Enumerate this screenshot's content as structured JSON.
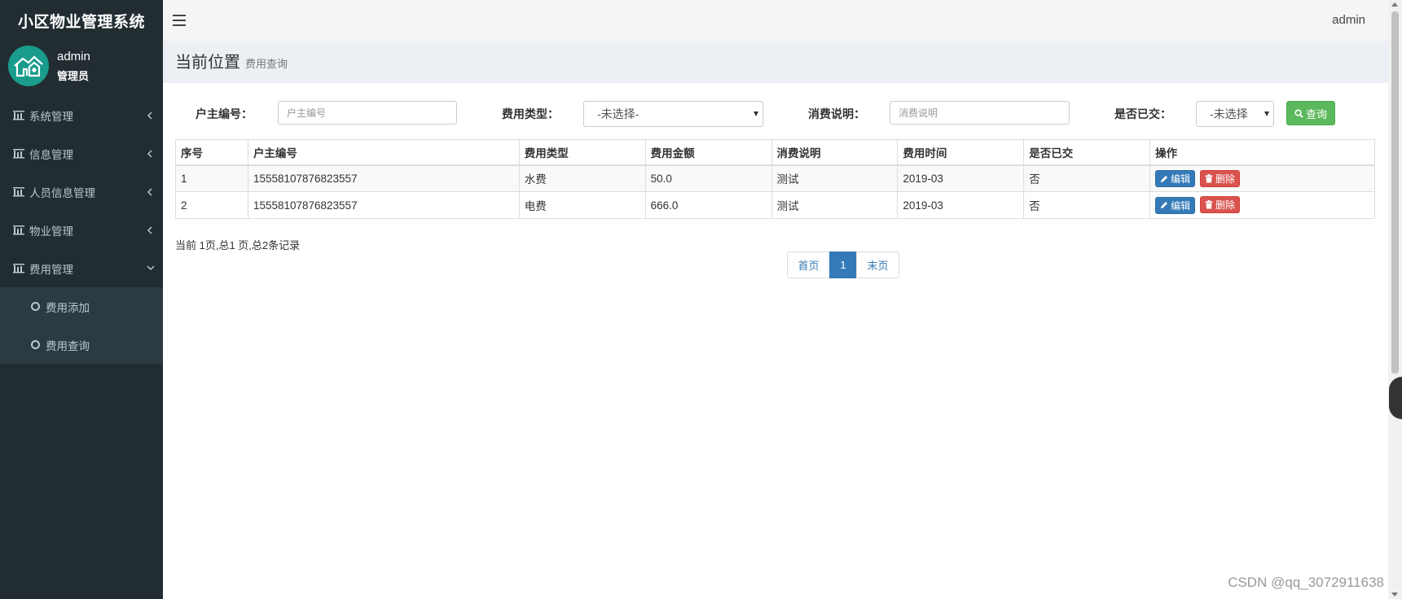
{
  "app": {
    "title": "小区物业管理系统"
  },
  "user": {
    "name": "admin",
    "role": "管理员"
  },
  "header": {
    "user": "admin"
  },
  "sidebar": {
    "items": [
      {
        "label": "系统管理"
      },
      {
        "label": "信息管理"
      },
      {
        "label": "人员信息管理"
      },
      {
        "label": "物业管理"
      },
      {
        "label": "费用管理"
      }
    ],
    "subitems": [
      {
        "label": "费用添加"
      },
      {
        "label": "费用查询"
      }
    ]
  },
  "breadcrumb": {
    "title": "当前位置",
    "current": "费用查询"
  },
  "filters": {
    "owner_label": "户主编号：",
    "owner_placeholder": "户主编号",
    "type_label": "费用类型：",
    "type_value": "-未选择-",
    "desc_label": "消费说明：",
    "desc_placeholder": "消费说明",
    "paid_label": "是否已交：",
    "paid_value": "-未选择",
    "search_label": "查询"
  },
  "table": {
    "headers": [
      "序号",
      "户主编号",
      "费用类型",
      "费用金额",
      "消费说明",
      "费用时间",
      "是否已交",
      "操作"
    ],
    "rows": [
      {
        "no": "1",
        "owner": "15558107876823557",
        "type": "水费",
        "amount": "50.0",
        "desc": "测试",
        "time": "2019-03",
        "paid": "否"
      },
      {
        "no": "2",
        "owner": "15558107876823557",
        "type": "电费",
        "amount": "666.0",
        "desc": "测试",
        "time": "2019-03",
        "paid": "否"
      }
    ],
    "edit_label": "编辑",
    "delete_label": "删除"
  },
  "pagination": {
    "info": "当前 1页,总1 页,总2条记录",
    "first": "首页",
    "current": "1",
    "last": "末页"
  },
  "watermark": "CSDN @qq_3072911638",
  "colors": {
    "sidebar": "#222d32",
    "accent": "#337ab7",
    "success": "#5cb85c",
    "danger": "#d9534f",
    "avatar": "#1a9c8c"
  }
}
